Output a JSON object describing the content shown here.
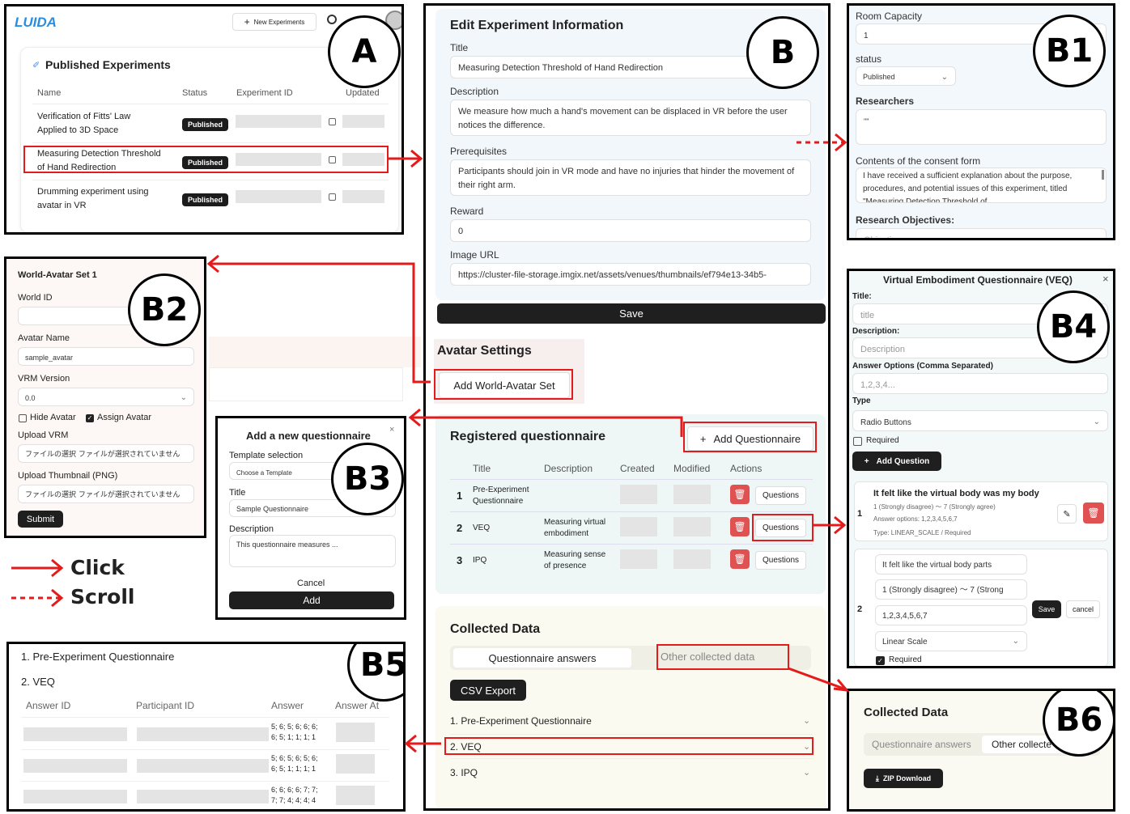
{
  "labels": {
    "A": "A",
    "B": "B",
    "B1": "B1",
    "B2": "B2",
    "B3": "B3",
    "B4": "B4",
    "B5": "B5",
    "B6": "B6"
  },
  "A": {
    "logo": "LUIDA",
    "new_exp": "New Experiments",
    "heading": "Published Experiments",
    "cols": [
      "Name",
      "Status",
      "Experiment ID",
      "Updated"
    ],
    "rows": [
      {
        "name": [
          "Verification of Fitts' Law",
          "Applied to 3D Space"
        ],
        "status": "Published"
      },
      {
        "name": [
          "Measuring Detection Threshold",
          "of Hand Redirection"
        ],
        "status": "Published"
      },
      {
        "name": [
          "Drumming experiment using",
          "avatar in VR"
        ],
        "status": "Published"
      }
    ]
  },
  "B": {
    "heading": "Edit Experiment Information",
    "title_label": "Title",
    "title_value": "Measuring Detection Threshold of Hand Redirection",
    "desc_label": "Description",
    "desc_value": "We measure how much a hand's movement can be displaced in VR before the user notices the difference.",
    "prereq_label": "Prerequisites",
    "prereq_value": "Participants should join in VR mode and have no injuries that hinder the movement of their right arm.",
    "reward_label": "Reward",
    "reward_value": "0",
    "image_label": "Image URL",
    "image_value": "https://cluster-file-storage.imgix.net/assets/venues/thumbnails/ef794e13-34b5-",
    "save": "Save",
    "avatar_heading": "Avatar Settings",
    "add_world": "Add World-Avatar Set",
    "reg_heading": "Registered questionnaire",
    "add_q": "Add Questionnaire",
    "q_cols": [
      "Title",
      "Description",
      "Created",
      "Modified",
      "Actions"
    ],
    "q_rows": [
      {
        "n": "1",
        "title": [
          "Pre-Experiment",
          "Questionnaire"
        ],
        "desc": [
          "",
          ""
        ],
        "btn": "Questions"
      },
      {
        "n": "2",
        "title": [
          "VEQ",
          ""
        ],
        "desc": [
          "Measuring virtual",
          "embodiment"
        ],
        "btn": "Questions"
      },
      {
        "n": "3",
        "title": [
          "IPQ",
          ""
        ],
        "desc": [
          "Measuring sense",
          "of presence"
        ],
        "btn": "Questions"
      }
    ],
    "collected_heading": "Collected Data",
    "tab1": "Questionnaire answers",
    "tab2": "Other collected data",
    "csv": "CSV Export",
    "acc": [
      "1. Pre-Experiment Questionnaire",
      "2. VEQ",
      "3. IPQ"
    ]
  },
  "B1": {
    "capacity_label": "Room Capacity",
    "capacity_value": "1",
    "status_label": "status",
    "status_value": "Published",
    "researchers_label": "Researchers",
    "researchers_value": "\"\"",
    "consent_label": "Contents of the consent form",
    "consent_value": "I have received a sufficient explanation about the purpose, procedures, and potential issues of this experiment, titled \"Measuring Detection Threshold of",
    "objectives_label": "Research Objectives:",
    "objectives_placeholder": "Objectives:"
  },
  "B2": {
    "heading": "World-Avatar Set 1",
    "world_id": "World ID",
    "avatar_name": "Avatar Name",
    "avatar_value": "sample_avatar",
    "vrm_version": "VRM Version",
    "vrm_value": "0.0",
    "hide": "Hide Avatar",
    "assign": "Assign Avatar",
    "upload_vrm": "Upload VRM",
    "file_text": "ファイルの選択 ファイルが選択されていません",
    "upload_thumb": "Upload Thumbnail (PNG)",
    "submit": "Submit"
  },
  "legend": {
    "click": "Click",
    "scroll": "Scroll"
  },
  "B3": {
    "heading": "Add a new questionnaire",
    "template_label": "Template selection",
    "template_placeholder": "Choose a Template",
    "title_label": "Title",
    "title_value": "Sample Questionnaire",
    "desc_label": "Description",
    "desc_value": "This questionnaire measures ...",
    "cancel": "Cancel",
    "add": "Add"
  },
  "B4": {
    "heading": "Virtual Embodiment Questionnaire (VEQ)",
    "title_label": "Title:",
    "title_ph": "title",
    "desc_label": "Description:",
    "desc_ph": "Description",
    "opts_label": "Answer Options (Comma Separated)",
    "opts_ph": "1,2,3,4...",
    "type_label": "Type",
    "type_value": "Radio Buttons",
    "required": "Required",
    "add_q": "Add Question",
    "q1": {
      "n": "1",
      "title": "It felt like the virtual body was my body",
      "scale": "1 (Strongly disagree) 〜 7 (Strongly agree)",
      "opts": "Answer options: 1,2,3,4,5,6,7",
      "type": "Type: LINEAR_SCALE / Required"
    },
    "q2": {
      "n": "2",
      "title": "It felt like the virtual body parts",
      "scale": "1 (Strongly disagree) 〜 7 (Strong",
      "opts": "1,2,3,4,5,6,7",
      "type": "Linear Scale",
      "save": "Save",
      "cancel": "cancel",
      "required": "Required"
    }
  },
  "B5": {
    "item1": "1. Pre-Experiment Questionnaire",
    "item2": "2. VEQ",
    "cols": [
      "Answer ID",
      "Participant ID",
      "Answer",
      "Answer At"
    ],
    "answers": [
      [
        "5; 6; 5; 6; 6; 6;",
        "6; 5; 1; 1; 1; 1"
      ],
      [
        "5; 6; 5; 6; 5; 6;",
        "6; 5; 1; 1; 1; 1"
      ],
      [
        "6; 6; 6; 6; 7; 7;",
        "7; 7; 4; 4; 4; 4"
      ]
    ]
  },
  "B6": {
    "heading": "Collected Data",
    "tab1": "Questionnaire answers",
    "tab2": "Other collecte",
    "zip": "ZIP Download"
  }
}
